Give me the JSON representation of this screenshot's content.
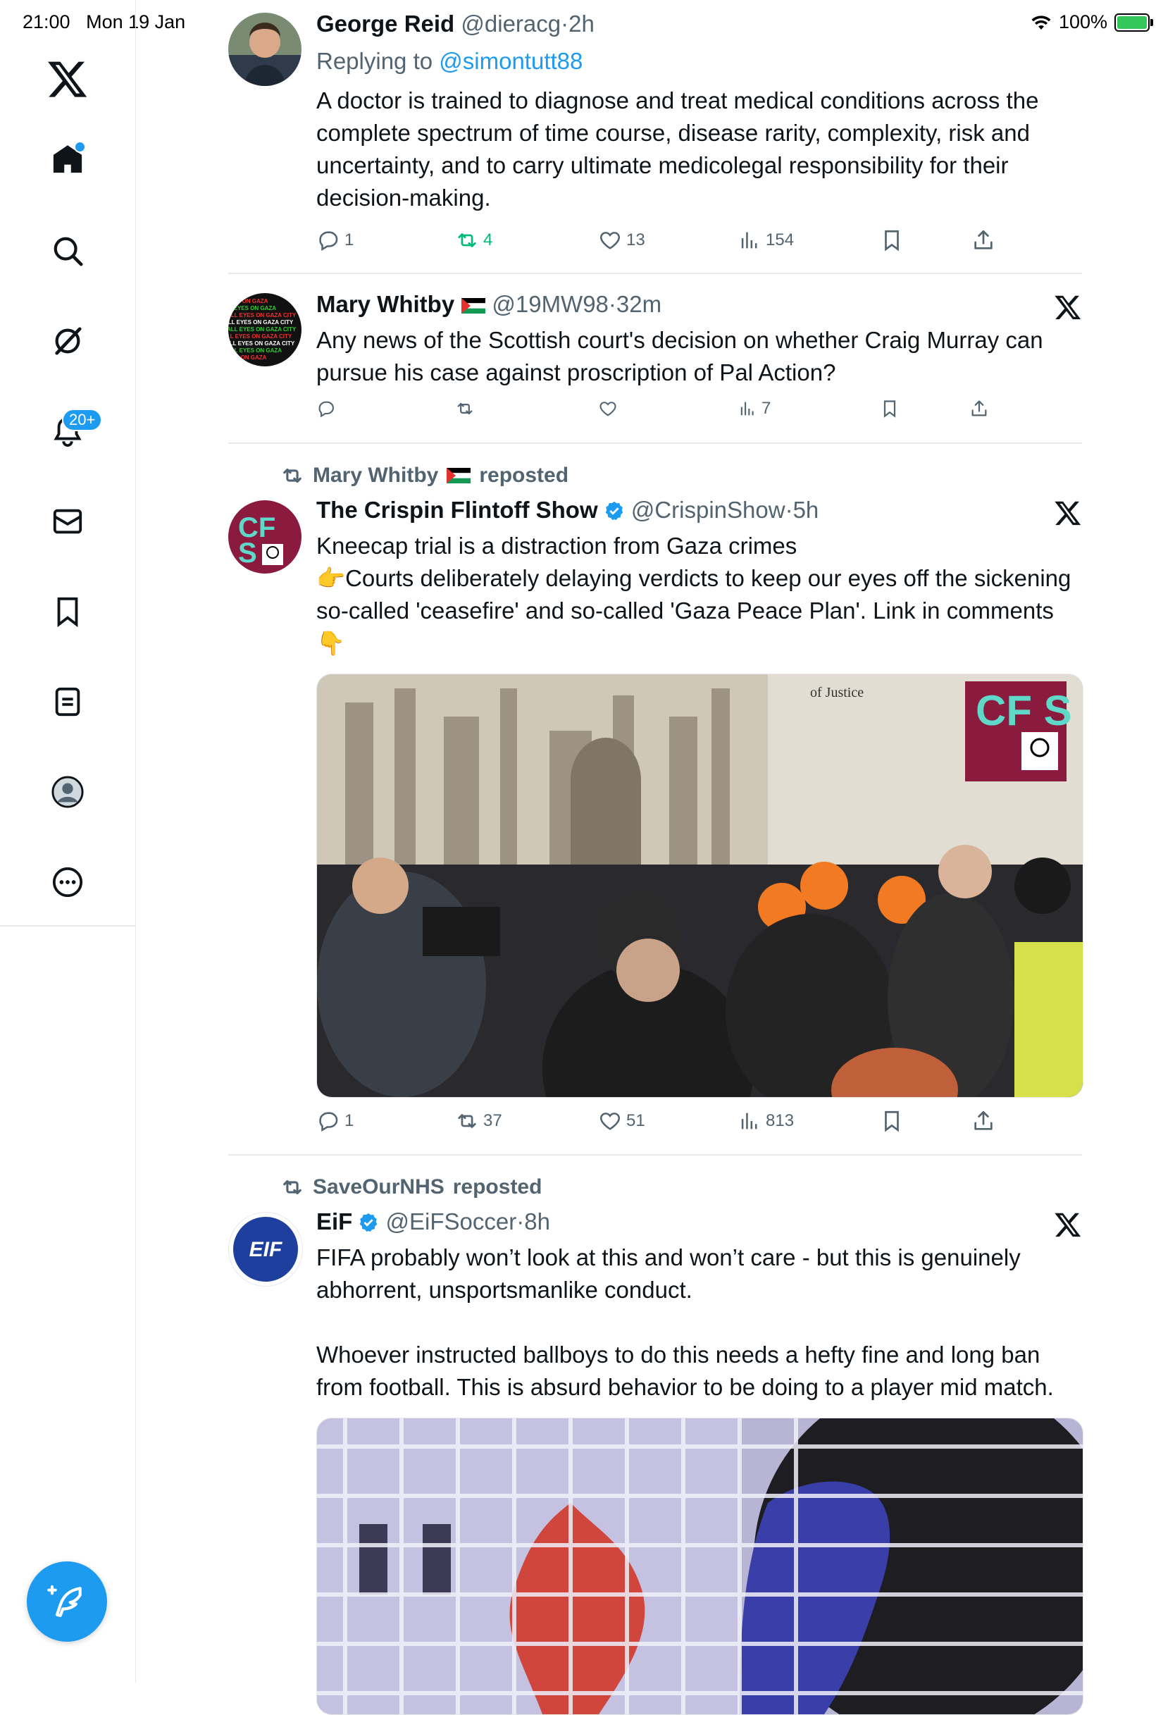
{
  "status": {
    "time": "21:00",
    "date": "Mon 19 Jan",
    "battery": "100%"
  },
  "nav": {
    "items": [
      {
        "name": "home",
        "label": "Home"
      },
      {
        "name": "search",
        "label": "Explore"
      },
      {
        "name": "grok",
        "label": "Grok"
      },
      {
        "name": "notifications",
        "label": "Notifications",
        "badge": "20+"
      },
      {
        "name": "messages",
        "label": "Messages"
      },
      {
        "name": "bookmarks",
        "label": "Bookmarks"
      },
      {
        "name": "lists",
        "label": "Lists"
      },
      {
        "name": "profile",
        "label": "Profile"
      },
      {
        "name": "more",
        "label": "More"
      }
    ],
    "notif_badge": "20+"
  },
  "tweets": [
    {
      "name": "George Reid",
      "handle": "@dieracg",
      "time": "2h",
      "reply_prefix": "Replying to ",
      "reply_to": "@simontutt88",
      "text": "A doctor is trained to diagnose and treat medical conditions across the complete spectrum of time course, disease rarity, complexity, risk and uncertainty, and to carry ultimate medicolegal responsibility for their decision-making.",
      "replies": "1",
      "reposts": "4",
      "likes": "13",
      "views": "154"
    },
    {
      "name": "Mary Whitby",
      "handle": "@19MW98",
      "time": "32m",
      "text": "Any news of the Scottish court's decision on whether Craig Murray can pursue his case against proscription of Pal Action?",
      "replies": "",
      "reposts": "",
      "likes": "",
      "views": "7"
    },
    {
      "reposted_by": "Mary Whitby",
      "reposted_label": "reposted",
      "name": "The Crispin Flintoff Show",
      "handle": "@CrispinShow",
      "time": "5h",
      "text": "Kneecap trial is a distraction from Gaza crimes\n👉Courts deliberately delaying verdicts to keep our eyes off the sickening so-called 'ceasefire' and so-called 'Gaza Peace Plan'. Link in comments 👇",
      "media_caption": "of Justice",
      "logo_text": "CF S",
      "replies": "1",
      "reposts": "37",
      "likes": "51",
      "views": "813"
    },
    {
      "reposted_by": "SaveOurNHS",
      "reposted_label": "reposted",
      "name": "EiF",
      "handle": "@EiFSoccer",
      "time": "8h",
      "avatar_text": "EIF",
      "text": "FIFA probably won’t look at this and won’t care - but this is genuinely abhorrent, unsportsmanlike conduct.\n\nWhoever instructed ballboys to do this needs a hefty fine and long ban from football. This is absurd behavior to be doing to a player mid match."
    }
  ],
  "colors": {
    "accent": "#1d9bf0",
    "repost_green": "#00ba7c",
    "muted": "#536471",
    "text": "#0f1419"
  }
}
